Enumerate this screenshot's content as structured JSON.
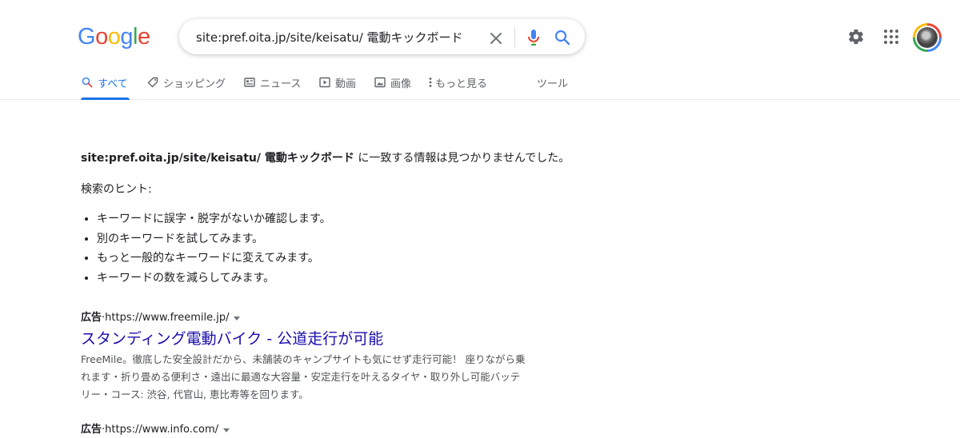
{
  "logo": {
    "letters": [
      "G",
      "o",
      "o",
      "g",
      "l",
      "e"
    ],
    "colors": [
      "#4285f4",
      "#ea4335",
      "#fbbc05",
      "#4285f4",
      "#34a853",
      "#ea4335"
    ]
  },
  "search": {
    "query": "site:pref.oita.jp/site/keisatu/ 電動キックボード"
  },
  "header_icons": {
    "clear": "close-icon",
    "mic": "microphone-icon",
    "search": "search-icon",
    "settings": "gear-icon",
    "apps": "apps-grid-icon"
  },
  "tabs": [
    {
      "label": "すべて",
      "icon": "search-icon",
      "active": true
    },
    {
      "label": "ショッピング",
      "icon": "tag-icon",
      "active": false
    },
    {
      "label": "ニュース",
      "icon": "newspaper-icon",
      "active": false
    },
    {
      "label": "動画",
      "icon": "play-icon",
      "active": false
    },
    {
      "label": "画像",
      "icon": "image-icon",
      "active": false
    },
    {
      "label": "もっと見る",
      "icon": "more-vertical-icon",
      "active": false
    },
    {
      "label": "ツール",
      "icon": "",
      "active": false
    }
  ],
  "results": {
    "no_results_query": "site:pref.oita.jp/site/keisatu/ 電動キックボード",
    "no_results_suffix": " に一致する情報は見つかりませんでした。",
    "hints_title": "検索のヒント:",
    "hints": [
      "キーワードに誤字・脱字がないか確認します。",
      "別のキーワードを試してみます。",
      "もっと一般的なキーワードに変えてみます。",
      "キーワードの数を減らしてみます。"
    ]
  },
  "ads": [
    {
      "label": "広告",
      "sep": " · ",
      "url": "https://www.freemile.jp/",
      "title": "スタンディング電動バイク - 公道走行が可能",
      "description": "FreeMile。徹底した安全設計だから、未舗装のキャンプサイトも気にせず走行可能！ 座りながら乗れます・折り畳める便利さ・遠出に最適な大容量・安定走行を叶えるタイヤ・取り外し可能バッテリー・コース: 渋谷, 代官山, 恵比寿等を回ります。"
    },
    {
      "label": "広告",
      "sep": " · ",
      "url": "https://www.info.com/"
    }
  ],
  "colors": {
    "accent": "#1a73e8",
    "link": "#1a0dab",
    "text": "#202124",
    "muted": "#5f6368"
  }
}
